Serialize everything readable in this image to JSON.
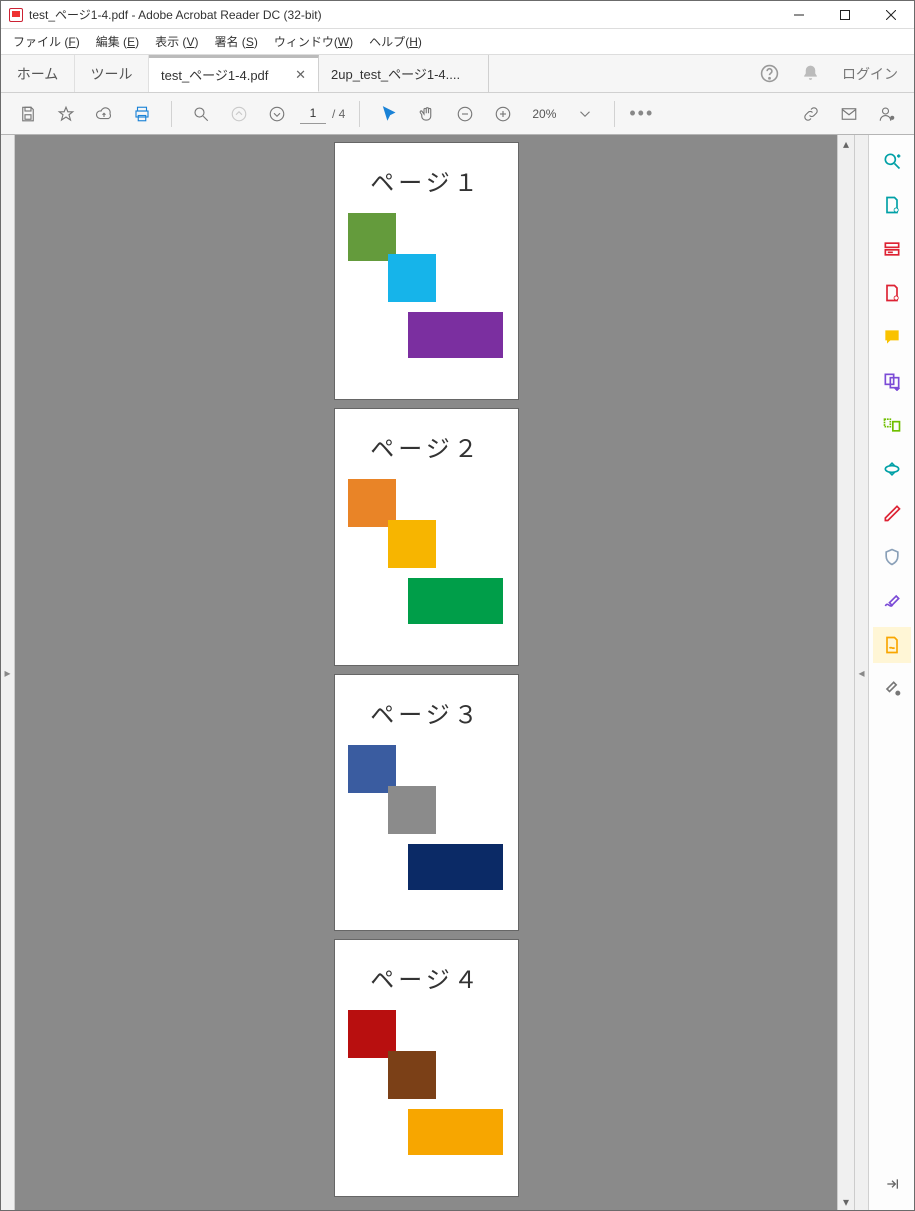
{
  "window": {
    "title": "test_ページ1-4.pdf - Adobe Acrobat Reader DC (32-bit)"
  },
  "menubar": {
    "file": {
      "label": "ファイル",
      "key": "F"
    },
    "edit": {
      "label": "編集",
      "key": "E"
    },
    "view": {
      "label": "表示",
      "key": "V"
    },
    "sign": {
      "label": "署名",
      "key": "S"
    },
    "window": {
      "label": "ウィンドウ",
      "key": "W"
    },
    "help": {
      "label": "ヘルプ",
      "key": "H"
    }
  },
  "tabs": {
    "home": "ホーム",
    "tools": "ツール",
    "docs": [
      {
        "label": "test_ページ1-4.pdf",
        "active": true
      },
      {
        "label": "2up_test_ページ1-4....",
        "active": false
      }
    ],
    "login": "ログイン"
  },
  "toolbar": {
    "page_current": "1",
    "page_total": "/ 4",
    "zoom_text": "20%"
  },
  "pages": [
    {
      "title": "ページ１",
      "c1": "#649b3c",
      "c2": "#16b4ea",
      "c3": "#7b2fa0"
    },
    {
      "title": "ページ２",
      "c1": "#e98427",
      "c2": "#f7b500",
      "c3": "#009e49"
    },
    {
      "title": "ページ３",
      "c1": "#3a5ca0",
      "c2": "#8b8b8b",
      "c3": "#0b2a66"
    },
    {
      "title": "ページ４",
      "c1": "#b80f0f",
      "c2": "#7b4017",
      "c3": "#f7a600"
    }
  ]
}
